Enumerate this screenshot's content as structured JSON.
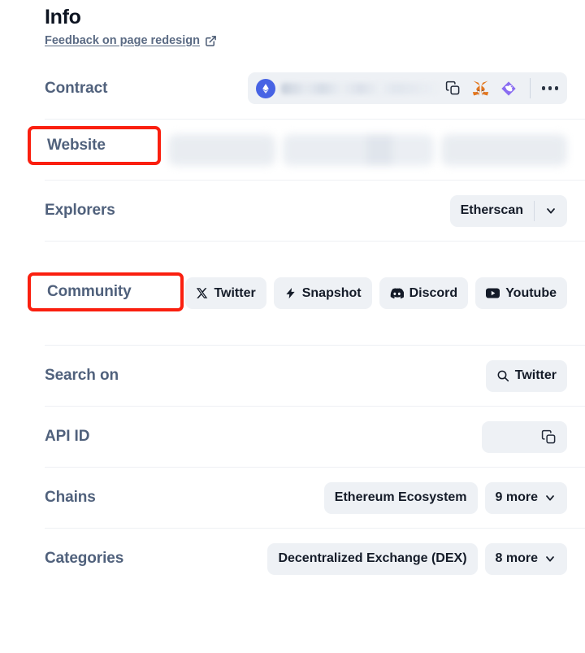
{
  "header": {
    "title": "Info",
    "feedback_link": "Feedback on page redesign",
    "external_icon": "external-link-icon"
  },
  "rows": {
    "contract": {
      "label": "Contract",
      "address": "",
      "address_redacted": true,
      "actions": [
        "copy-icon",
        "metamask-icon",
        "rabby-wallet-icon",
        "more-options-icon"
      ],
      "chain_icon": "ethereum-icon"
    },
    "website": {
      "label": "Website",
      "links_redacted": true,
      "link_count": 3,
      "annotated": true
    },
    "explorers": {
      "label": "Explorers",
      "selected": "Etherscan",
      "chevron": "chevron-down-icon"
    },
    "community": {
      "label": "Community",
      "annotated": true,
      "links": [
        {
          "label": "Twitter",
          "icon": "x-twitter-icon"
        },
        {
          "label": "Snapshot",
          "icon": "lightning-bolt-icon"
        },
        {
          "label": "Discord",
          "icon": "discord-icon"
        },
        {
          "label": "Youtube",
          "icon": "youtube-icon"
        }
      ]
    },
    "search_on": {
      "label": "Search on",
      "target": "Twitter",
      "icon": "search-icon"
    },
    "api_id": {
      "label": "API ID",
      "value": "",
      "value_redacted": true,
      "copy_icon": "copy-icon"
    },
    "chains": {
      "label": "Chains",
      "primary": "Ethereum Ecosystem",
      "more": "9 more",
      "chevron": "chevron-down-icon"
    },
    "categories": {
      "label": "Categories",
      "primary": "Decentralized Exchange (DEX)",
      "more": "8 more",
      "chevron": "chevron-down-icon"
    }
  },
  "colors": {
    "label": "#50617c",
    "pill_bg": "#eef1f5",
    "pill_text": "#141b28",
    "annotation": "#fa1f0f",
    "link": "#5b6b84",
    "ethereum": "#4763e4"
  }
}
